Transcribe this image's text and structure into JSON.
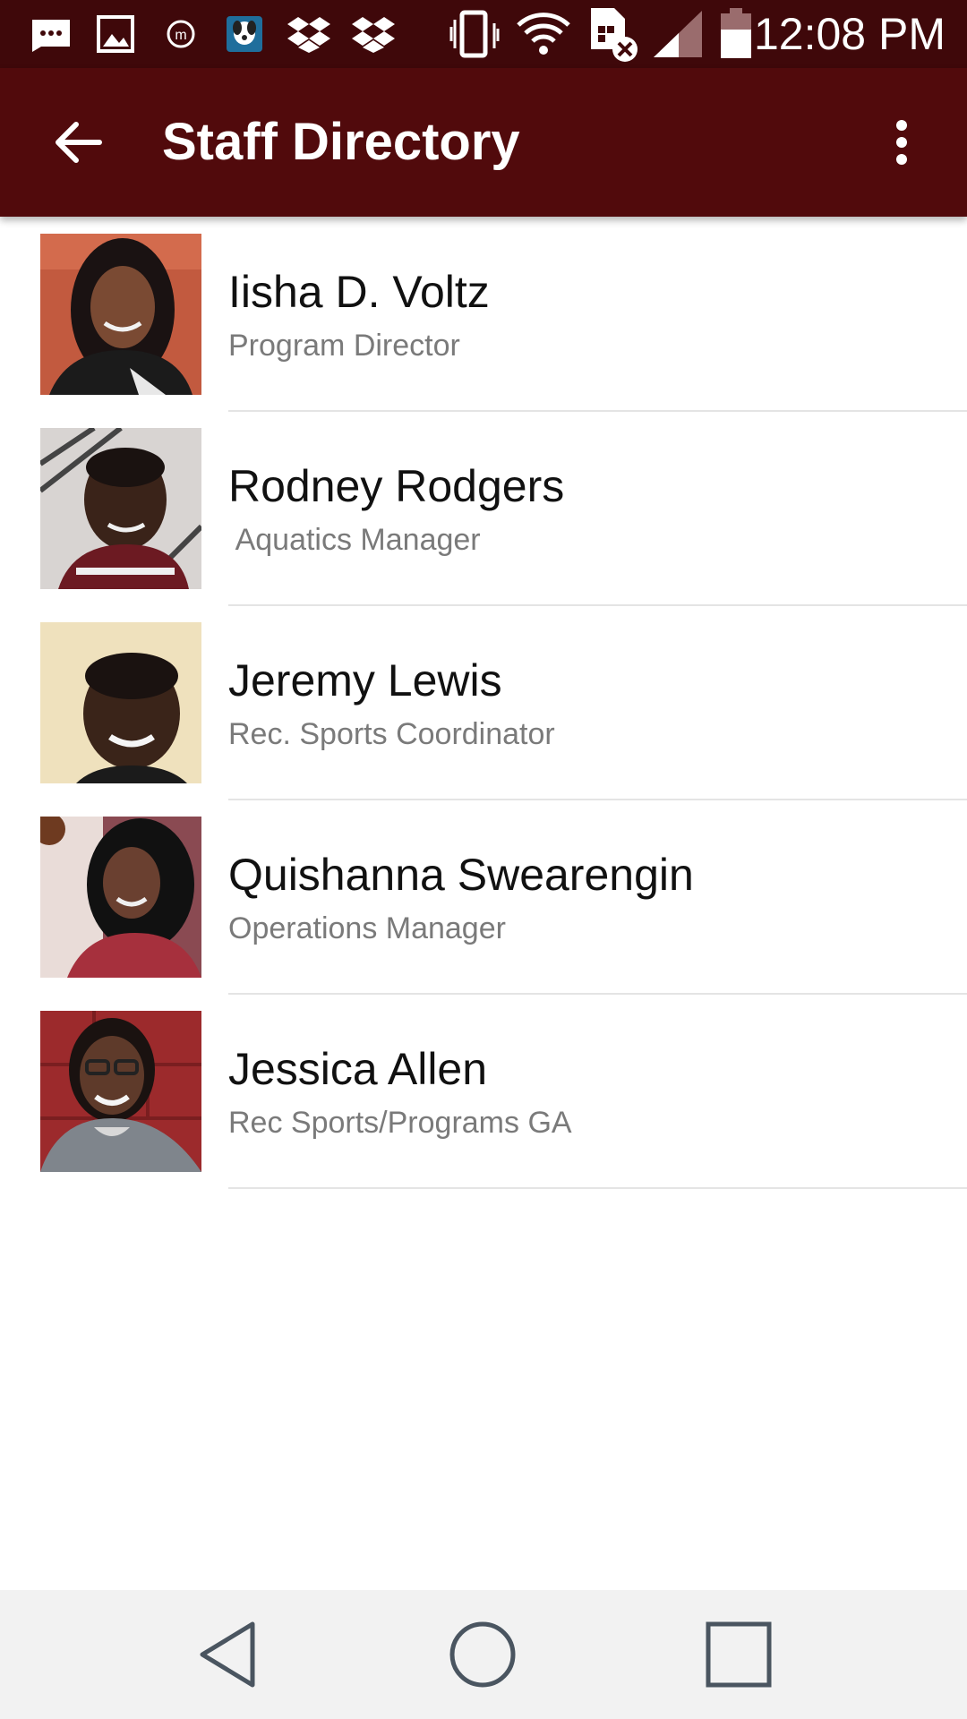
{
  "status_bar": {
    "time": "12:08 PM",
    "icons": [
      "message-icon",
      "image-icon",
      "m-circle-icon",
      "dog-app-icon",
      "dropbox-icon",
      "dropbox-icon",
      "vibrate-icon",
      "wifi-icon",
      "sim-missing-icon",
      "signal-icon",
      "battery-icon"
    ]
  },
  "app_bar": {
    "title": "Staff Directory",
    "back_icon": "arrow-back-icon",
    "menu_icon": "more-vert-icon",
    "color": "#510a0c"
  },
  "staff": [
    {
      "name": "Iisha D. Voltz",
      "role": "Program Director"
    },
    {
      "name": "Rodney Rodgers",
      "role": " Aquatics Manager"
    },
    {
      "name": "Jeremy Lewis",
      "role": "Rec. Sports Coordinator"
    },
    {
      "name": "Quishanna Swearengin",
      "role": "Operations Manager"
    },
    {
      "name": "Jessica Allen",
      "role": "Rec Sports/Programs GA"
    }
  ],
  "nav_bar": {
    "icons": [
      "back-triangle-icon",
      "home-circle-icon",
      "recents-square-icon"
    ]
  }
}
